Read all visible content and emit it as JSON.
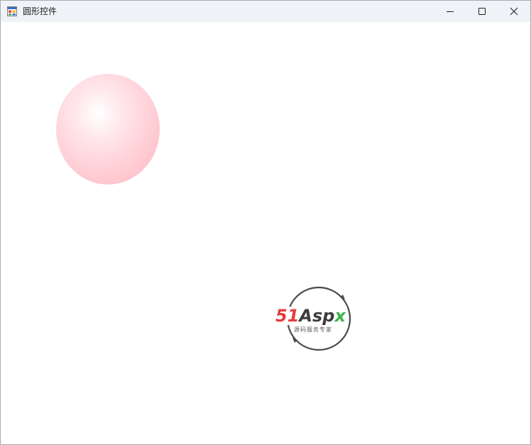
{
  "window": {
    "title": "圆形控件",
    "icons": {
      "app": "winforms-app-icon",
      "minimize": "minimize-icon",
      "maximize": "maximize-icon",
      "close": "close-icon"
    }
  },
  "round_control": {
    "shape": "ellipse",
    "colors": {
      "highlight": "#ffffff",
      "fill": "#ffd3d9",
      "edge": "#ffc0c9"
    }
  },
  "watermark": {
    "brand_number": "51",
    "brand_name": "Asp",
    "brand_suffix": "x",
    "tagline": "源码服务专家",
    "colors": {
      "number": "#e63b3b",
      "name": "#3d3d3d",
      "suffix": "#3bb54a",
      "ring": "#4a4a4a"
    }
  }
}
